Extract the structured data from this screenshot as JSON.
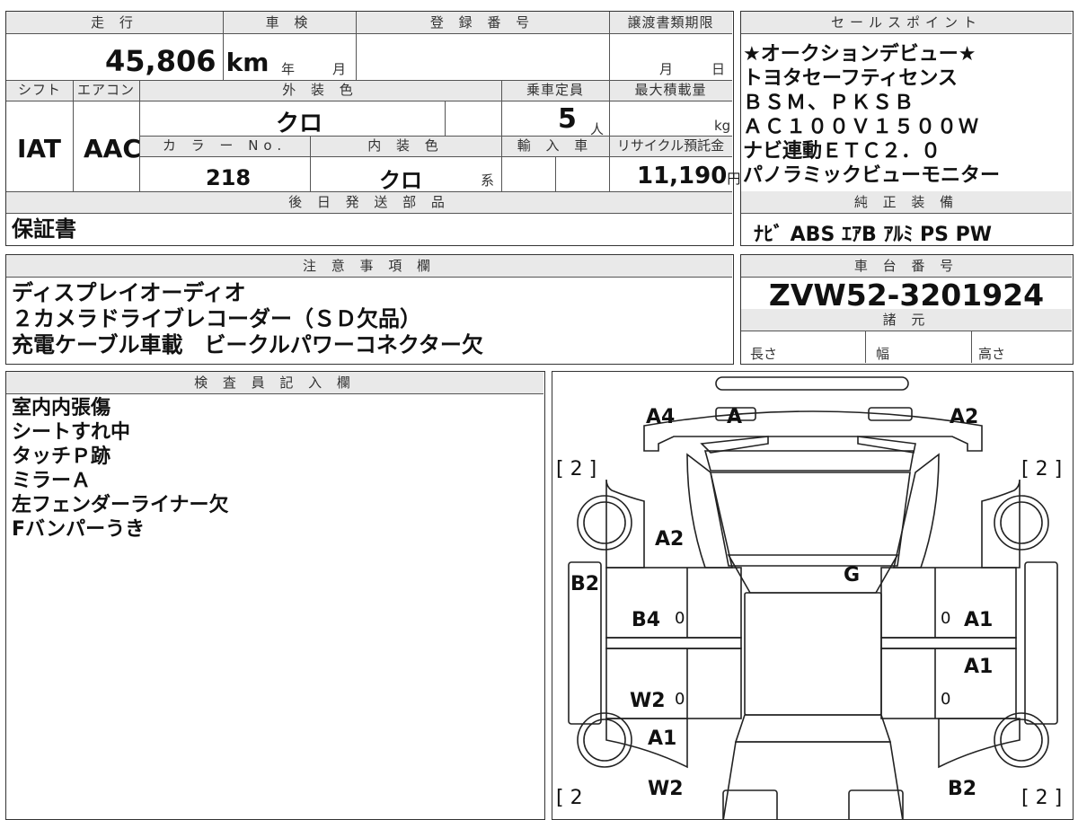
{
  "headers": {
    "mileage": "走 行",
    "inspection": "車 検",
    "registration": "登 録 番 号",
    "transfer_deadline": "譲渡書類期限",
    "sales_point": "セールスポイント",
    "shift": "シフト",
    "aircon": "エアコン",
    "exterior_color": "外 装 色",
    "capacity": "乗車定員",
    "max_load": "最大積載量",
    "color_no": "カ ラ ー No.",
    "interior_color": "内 装 色",
    "import_car": "輸 入 車",
    "recycle_fee": "リサイクル預託金",
    "later_parts": "後 日 発 送 部 品",
    "genuine_equipment": "純 正 装 備",
    "notes": "注 意 事 項 欄",
    "chassis_no": "車 台 番 号",
    "specs": "諸 元",
    "inspector": "検 査 員 記 入 欄"
  },
  "values": {
    "mileage": "45,806",
    "mileage_unit": "km",
    "inspection_year": "年",
    "inspection_month": "月",
    "deadline_month": "月",
    "deadline_day": "日",
    "shift": "IAT",
    "aircon": "AAC",
    "exterior_color": "クロ",
    "capacity": "5",
    "capacity_unit": "人",
    "max_load_unit": "kg",
    "color_no": "218",
    "interior_color": "クロ",
    "interior_suffix": "系",
    "recycle_fee": "11,190",
    "recycle_unit": "円",
    "later_parts": "保証書",
    "genuine_equipment": "ﾅﾋﾞ ABS ｴｱB ｱﾙﾐ PS PW",
    "chassis_no": "ZVW52-3201924",
    "spec_length": "長さ",
    "spec_width": "幅",
    "spec_height": "高さ"
  },
  "sales_points": [
    "★オークションデビュー★",
    "トヨタセーフティセンス",
    "ＢＳＭ、ＰＫＳＢ",
    "ＡＣ１００Ｖ１５００Ｗ",
    "ナビ連動ＥＴＣ２．０",
    "パノラミックビューモニター"
  ],
  "notes": [
    "ディスプレイオーディオ",
    "２カメラドライブレコーダー（ＳＤ欠品）",
    "充電ケーブル車載　ビークルパワーコネクター欠"
  ],
  "inspector_notes": [
    "室内内張傷",
    "シートすれ中",
    "タッチＰ跡",
    "ミラーＡ",
    "左フェンダーライナー欠",
    "Fバンパーうき"
  ],
  "diagram": {
    "labels": {
      "a4": "A4",
      "a": "A",
      "a2_top": "A2",
      "a2_hood": "A2",
      "g": "G",
      "b2_left": "B2",
      "b4": "B4",
      "a1_right1": "A1",
      "a1_right2": "A1",
      "w2_left": "W2",
      "a1_left": "A1",
      "w2_bottom": "W2",
      "b2_bottom": "B2"
    },
    "zeros": {
      "z1": "0",
      "z2": "0",
      "z3": "0",
      "z4": "0"
    },
    "tires": {
      "tl": "[ 2 ]",
      "tr": "[ 2 ]",
      "bl": "[ 2",
      "br": "[ 2 ]"
    }
  }
}
